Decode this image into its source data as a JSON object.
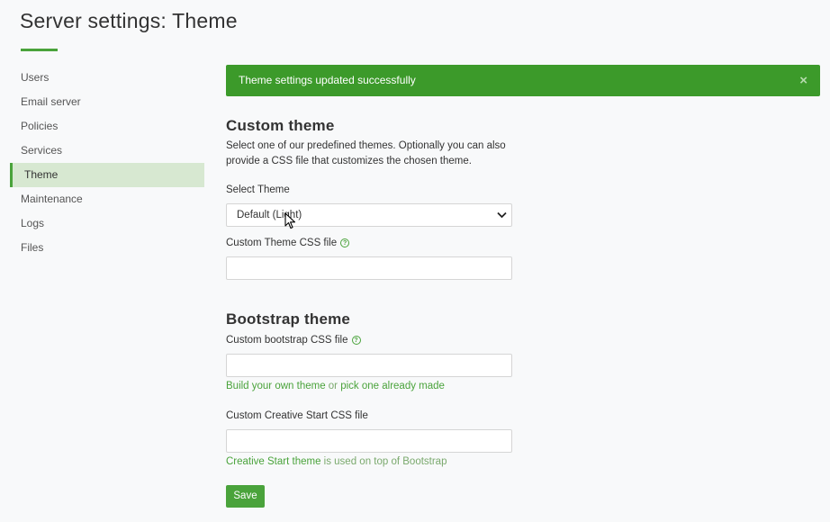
{
  "page": {
    "title": "Server settings: Theme"
  },
  "sidebar": {
    "items": [
      {
        "label": "Users",
        "active": false
      },
      {
        "label": "Email server",
        "active": false
      },
      {
        "label": "Policies",
        "active": false
      },
      {
        "label": "Services",
        "active": false
      },
      {
        "label": "Theme",
        "active": true
      },
      {
        "label": "Maintenance",
        "active": false
      },
      {
        "label": "Logs",
        "active": false
      },
      {
        "label": "Files",
        "active": false
      }
    ]
  },
  "alert": {
    "message": "Theme settings updated successfully",
    "close": "×"
  },
  "custom_theme": {
    "title": "Custom theme",
    "description": "Select one of our predefined themes. Optionally you can also provide a CSS file that customizes the chosen theme.",
    "select_label": "Select Theme",
    "select_value": "Default (Light)",
    "css_label": "Custom Theme CSS file",
    "css_value": ""
  },
  "bootstrap_theme": {
    "title": "Bootstrap theme",
    "css_label": "Custom bootstrap CSS file",
    "css_value": "",
    "hint_link1": "Build your own theme",
    "hint_middle": " or ",
    "hint_link2": "pick one already made",
    "cs_label": "Custom Creative Start CSS file",
    "cs_value": "",
    "cs_hint_link": "Creative Start theme",
    "cs_hint_rest": " is used on top of Bootstrap"
  },
  "save_label": "Save",
  "colors": {
    "accent": "#4aa33b",
    "alert_bg": "#3c9a2a",
    "active_bg": "#d7e8d1",
    "background": "#f8f9fa"
  }
}
